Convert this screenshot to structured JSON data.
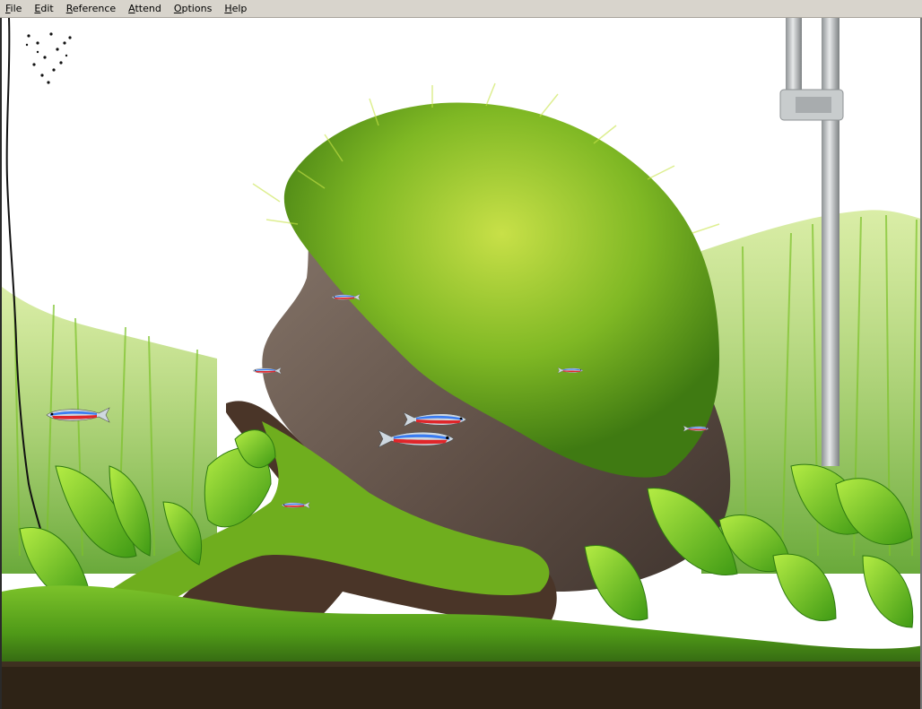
{
  "window": {
    "menu": [
      {
        "id": "file",
        "mnemonic": "F",
        "rest": "ile"
      },
      {
        "id": "edit",
        "mnemonic": "E",
        "rest": "dit"
      },
      {
        "id": "reference",
        "mnemonic": "R",
        "rest": "eference"
      },
      {
        "id": "attend",
        "mnemonic": "A",
        "rest": "ttend"
      },
      {
        "id": "options",
        "mnemonic": "O",
        "rest": "ptions"
      },
      {
        "id": "help",
        "mnemonic": "H",
        "rest": "elp"
      }
    ]
  },
  "colors": {
    "menubar_bg": "#d8d4cc",
    "water_bg": "#ffffff",
    "moss_light": "#b8d640",
    "moss_mid": "#6fae1e",
    "moss_dark": "#3f7a12",
    "rock": "#6b5a50",
    "rock_dark": "#3e332d",
    "wood": "#4a3528",
    "leaf": "#5cc41c",
    "leaf_light": "#a6e43a",
    "substrate": "#2e2316",
    "tube": "#b9bcbe",
    "fish_red": "#e0262a",
    "fish_blue": "#3a7cf2"
  },
  "scene": {
    "fish": [
      {
        "name": "neon-tetra",
        "dir": "left"
      },
      {
        "name": "neon-tetra",
        "dir": "right"
      },
      {
        "name": "neon-tetra",
        "dir": "right"
      },
      {
        "name": "neon-tetra-small",
        "dir": "left"
      },
      {
        "name": "neon-tetra-small",
        "dir": "left"
      },
      {
        "name": "neon-tetra-small",
        "dir": "right"
      },
      {
        "name": "neon-tetra-small",
        "dir": "right"
      },
      {
        "name": "neon-tetra-small",
        "dir": "left"
      }
    ]
  }
}
